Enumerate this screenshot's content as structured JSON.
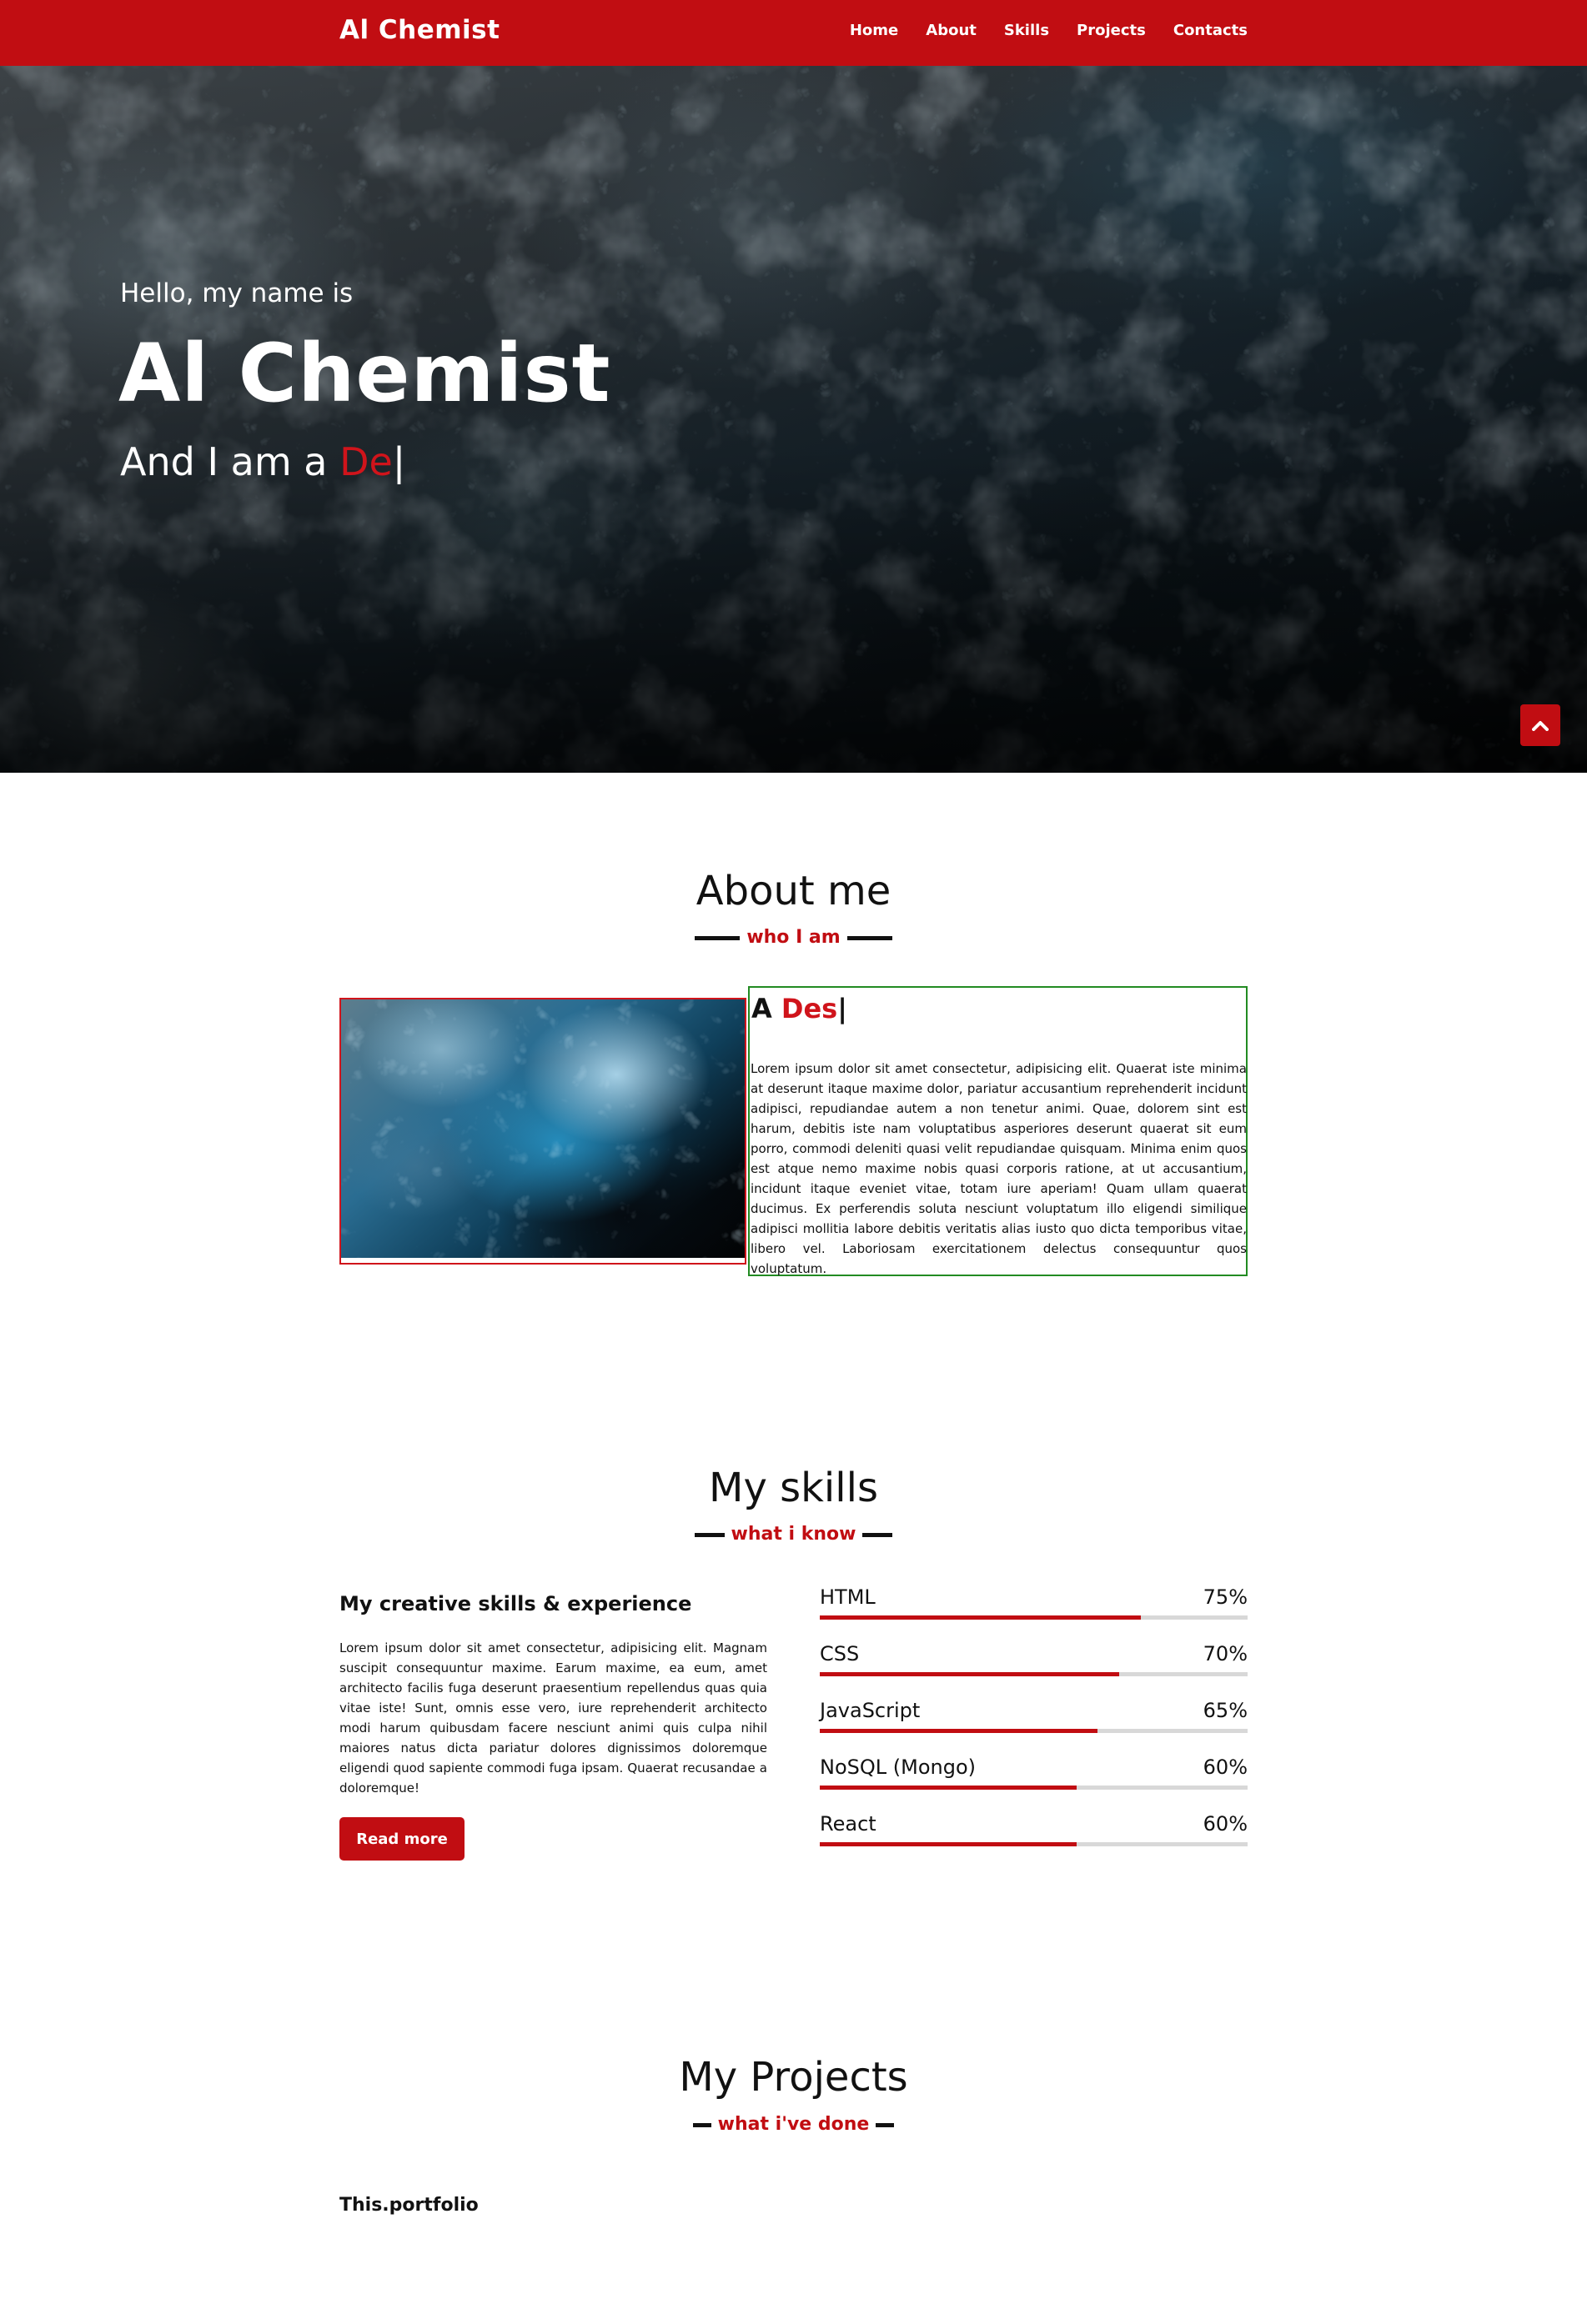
{
  "navbar": {
    "brand": "Al Chemist",
    "menu": [
      "Home",
      "About",
      "Skills",
      "Projects",
      "Contacts"
    ]
  },
  "hero": {
    "greeting": "Hello, my name is",
    "name": "Al Chemist",
    "role_prefix": "And I am a ",
    "role_typed": "De",
    "cursor": "|"
  },
  "about": {
    "title": "About me",
    "subtitle": "who I am",
    "heading_prefix": "A ",
    "heading_typed": "Des",
    "cursor": "|",
    "text": "Lorem ipsum dolor sit amet consectetur, adipisicing elit. Quaerat iste minima at deserunt itaque maxime dolor, pariatur accusantium reprehenderit incidunt adipisci, repudiandae autem a non tenetur animi. Quae, dolorem sint est harum, debitis iste nam voluptatibus asperiores deserunt quaerat sit eum porro, commodi deleniti quasi velit repudiandae quisquam. Minima enim quos est atque nemo maxime nobis quasi corporis ratione, at ut accusantium, incidunt itaque eveniet vitae, totam iure aperiam! Quam ullam quaerat ducimus. Ex perferendis soluta nesciunt voluptatum illo eligendi similique adipisci mollitia labore debitis veritatis alias iusto quo dicta temporibus vitae, libero vel. Laboriosam exercitationem delectus consequuntur quos voluptatum."
  },
  "skills": {
    "title": "My skills",
    "subtitle": "what i know",
    "left_title": "My creative skills & experience",
    "left_text": "Lorem ipsum dolor sit amet consectetur, adipisicing elit. Magnam suscipit consequuntur maxime. Earum maxime, ea eum, amet architecto facilis fuga deserunt praesentium repellendus quas quia vitae iste! Sunt, omnis esse vero, iure reprehenderit architecto modi harum quibusdam facere nesciunt animi quis culpa nihil maiores natus dicta pariatur dolores dignissimos doloremque eligendi quod sapiente commodi fuga ipsam. Quaerat recusandae a doloremque!",
    "read_more": "Read more",
    "items": [
      {
        "name": "HTML",
        "percent_label": "75%",
        "value": 75
      },
      {
        "name": "CSS",
        "percent_label": "70%",
        "value": 70
      },
      {
        "name": "JavaScript",
        "percent_label": "65%",
        "value": 65
      },
      {
        "name": "NoSQL (Mongo)",
        "percent_label": "60%",
        "value": 60
      },
      {
        "name": "React",
        "percent_label": "60%",
        "value": 60
      }
    ]
  },
  "projects": {
    "title": "My Projects",
    "subtitle": "what i've done",
    "first_project": "This.portfolio"
  },
  "colors": {
    "accent": "#c10d12",
    "about_image_border": "#d0141b",
    "about_text_border": "#228b22",
    "bar_track": "#d8d8d8"
  },
  "icons": {
    "scroll_top": "chevron-up-icon"
  }
}
